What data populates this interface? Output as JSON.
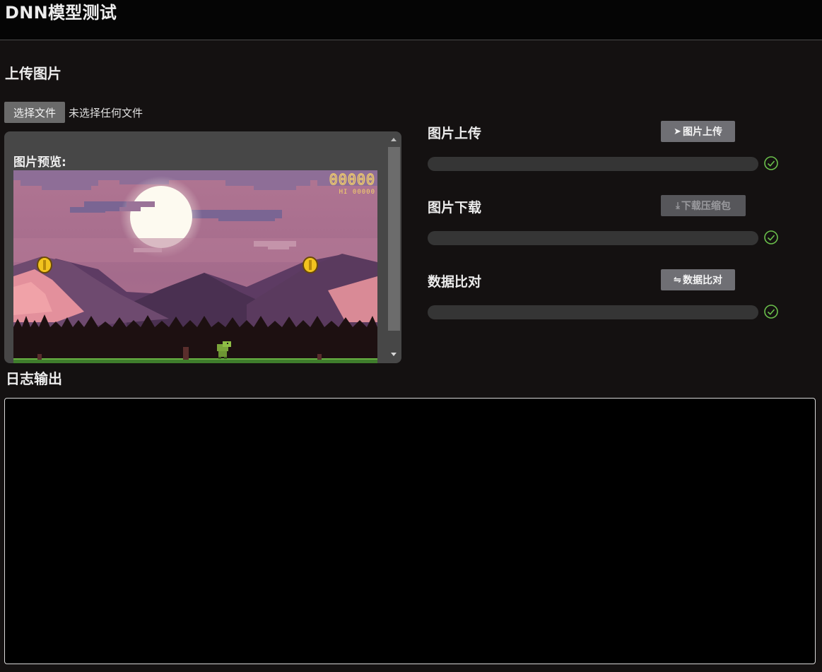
{
  "app": {
    "title": "DNN模型测试"
  },
  "upload": {
    "section_title": "上传图片",
    "file_button_label": "选择文件",
    "file_status": "未选择任何文件",
    "preview_label": "图片预览:"
  },
  "preview_image": {
    "score": "00000",
    "hi_score": "HI 00000"
  },
  "operations": [
    {
      "label": "图片上传",
      "button_label": "图片上传",
      "button_icon": "send-icon",
      "button_icon_glyph": "➤",
      "progress_percent": 0,
      "status_icon": "check-circle-icon"
    },
    {
      "label": "图片下载",
      "button_label": "下载压缩包",
      "button_icon": "download-icon",
      "button_icon_glyph": "⤓",
      "progress_percent": 0,
      "status_icon": "check-circle-icon"
    },
    {
      "label": "数据比对",
      "button_label": "数据比对",
      "button_icon": "swap-icon",
      "button_icon_glyph": "⇋",
      "progress_percent": 0,
      "status_icon": "check-circle-icon"
    }
  ],
  "log": {
    "section_title": "日志输出",
    "content": ""
  },
  "colors": {
    "success": "#6abf4b",
    "progress_track": "#353535",
    "page_bg": "#141111"
  }
}
